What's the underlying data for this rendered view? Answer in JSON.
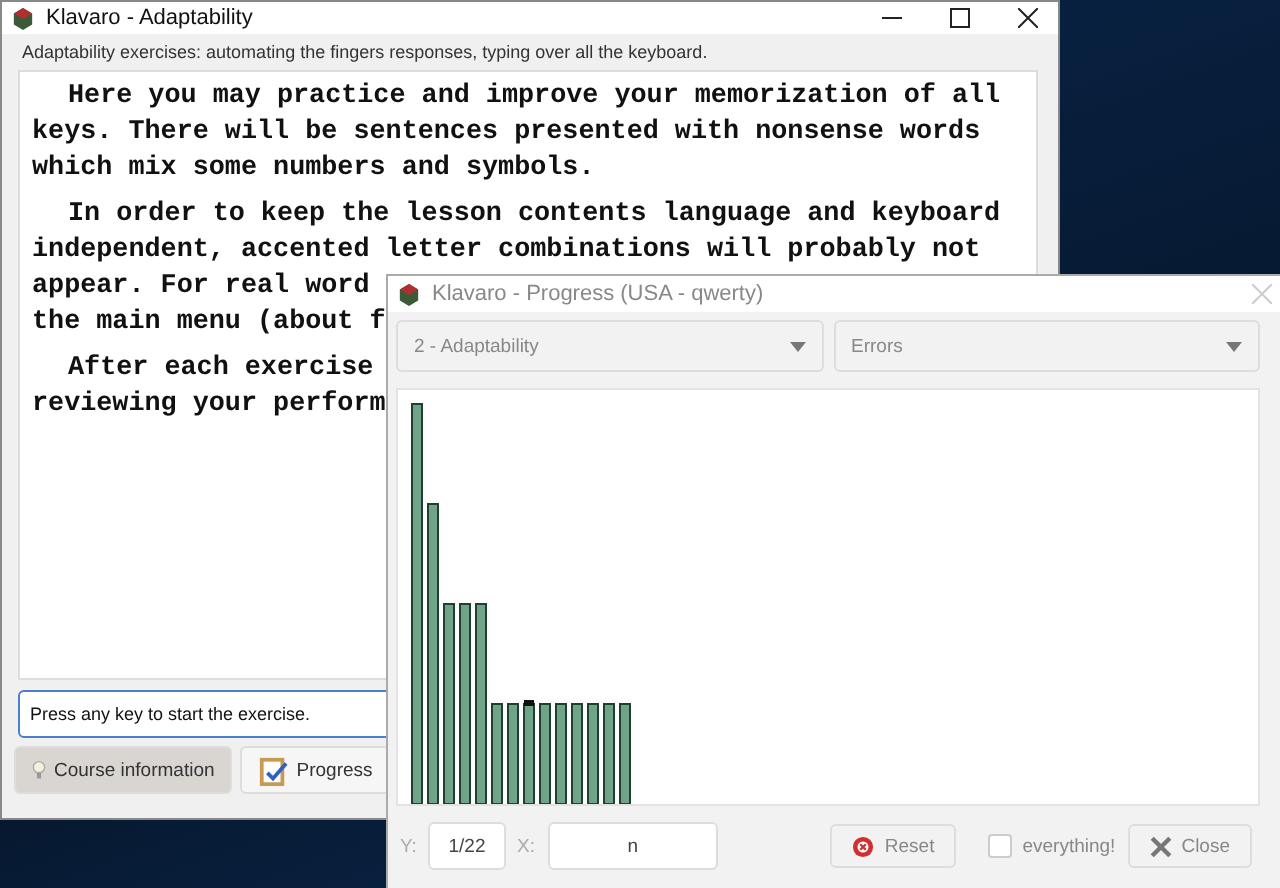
{
  "main_window": {
    "title": "Klavaro - Adaptability",
    "subtitle": "Adaptability exercises: automating the fingers responses, typing over all the keyboard.",
    "paragraphs": [
      [
        "Here you may practice and improve your memorization of all",
        "keys. There will be sentences presented with nonsense words",
        "which mix some numbers and symbols."
      ],
      [
        "In order to keep the lesson contents language and keyboard",
        "independent, accented letter combinations will probably not",
        "appear. For real word",
        "the main menu (about f"
      ],
      [
        "After each exercise",
        "reviewing your perform"
      ]
    ],
    "input": {
      "value": "Press any key to start the exercise."
    },
    "buttons": [
      {
        "label": "Course information",
        "kind": "info",
        "selected": true
      },
      {
        "label": "Progress",
        "kind": "progress",
        "selected": false
      }
    ]
  },
  "progress_window": {
    "title": "Klavaro - Progress (USA - qwerty)",
    "lesson_select": {
      "value": "2 - Adaptability"
    },
    "metric_select": {
      "value": "Errors"
    },
    "y_label": "Y:",
    "y_value": "1/22",
    "x_label": "X:",
    "x_value": "n",
    "reset_button": "Reset",
    "everything": {
      "label": "everything!",
      "checked": false
    },
    "close_button": "Close"
  }
}
